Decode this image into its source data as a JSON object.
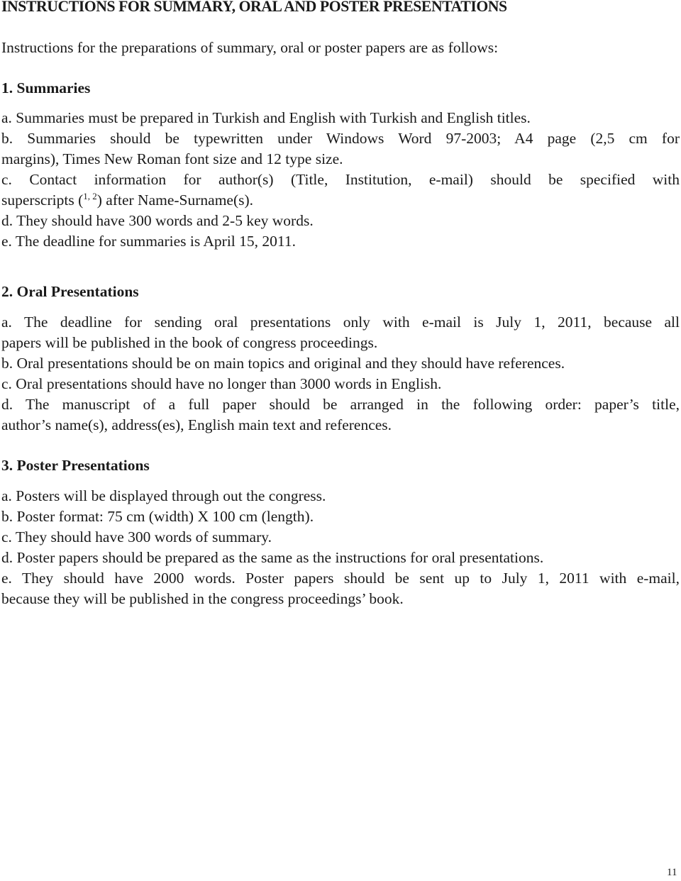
{
  "document": {
    "title": "INSTRUCTIONS FOR SUMMARY, ORAL AND POSTER PRESENTATIONS",
    "intro": "Instructions for the preparations of summary, oral or poster papers are as follows:",
    "sections": [
      {
        "heading": "1. Summaries",
        "items": [
          "a. Summaries must be prepared in Turkish and English with Turkish and English titles.",
          "b. Summaries should be typewritten under Windows Word 97-2003; A4 page (2,5 cm for",
          "margins), Times New Roman font size and 12 type size.",
          "c. Contact information for author(s) (Title, Institution, e-mail) should be specified with",
          {
            "before": "superscripts (",
            "sup": "1, 2",
            "after": ") after Name-Surname(s)."
          },
          "d. They should have 300 words and 2-5 key words.",
          "e. The deadline for summaries is April 15, 2011."
        ]
      },
      {
        "heading": "2. Oral Presentations",
        "items": [
          "a. The deadline for sending oral presentations only with e-mail is July 1, 2011, because all",
          "papers will be published in the book of congress proceedings.",
          "b. Oral presentations should be on main topics and original and they should have references.",
          "c. Oral presentations should have no longer than 3000 words in English.",
          "d. The manuscript of a full paper should be arranged in the following order: paper’s title,",
          "author’s name(s), address(es), English main text and references."
        ]
      },
      {
        "heading": "3. Poster Presentations",
        "items": [
          "a. Posters will be displayed through out the congress.",
          "b. Poster format: 75 cm (width) X 100 cm (length).",
          "c. They should have 300 words of summary.",
          "d. Poster papers should be prepared as the same as the instructions for oral presentations.",
          "e. They should have 2000 words. Poster papers should be sent up to July 1, 2011 with e-mail,",
          "because they will be published in the congress proceedings’ book."
        ]
      }
    ],
    "page_number": "11"
  }
}
